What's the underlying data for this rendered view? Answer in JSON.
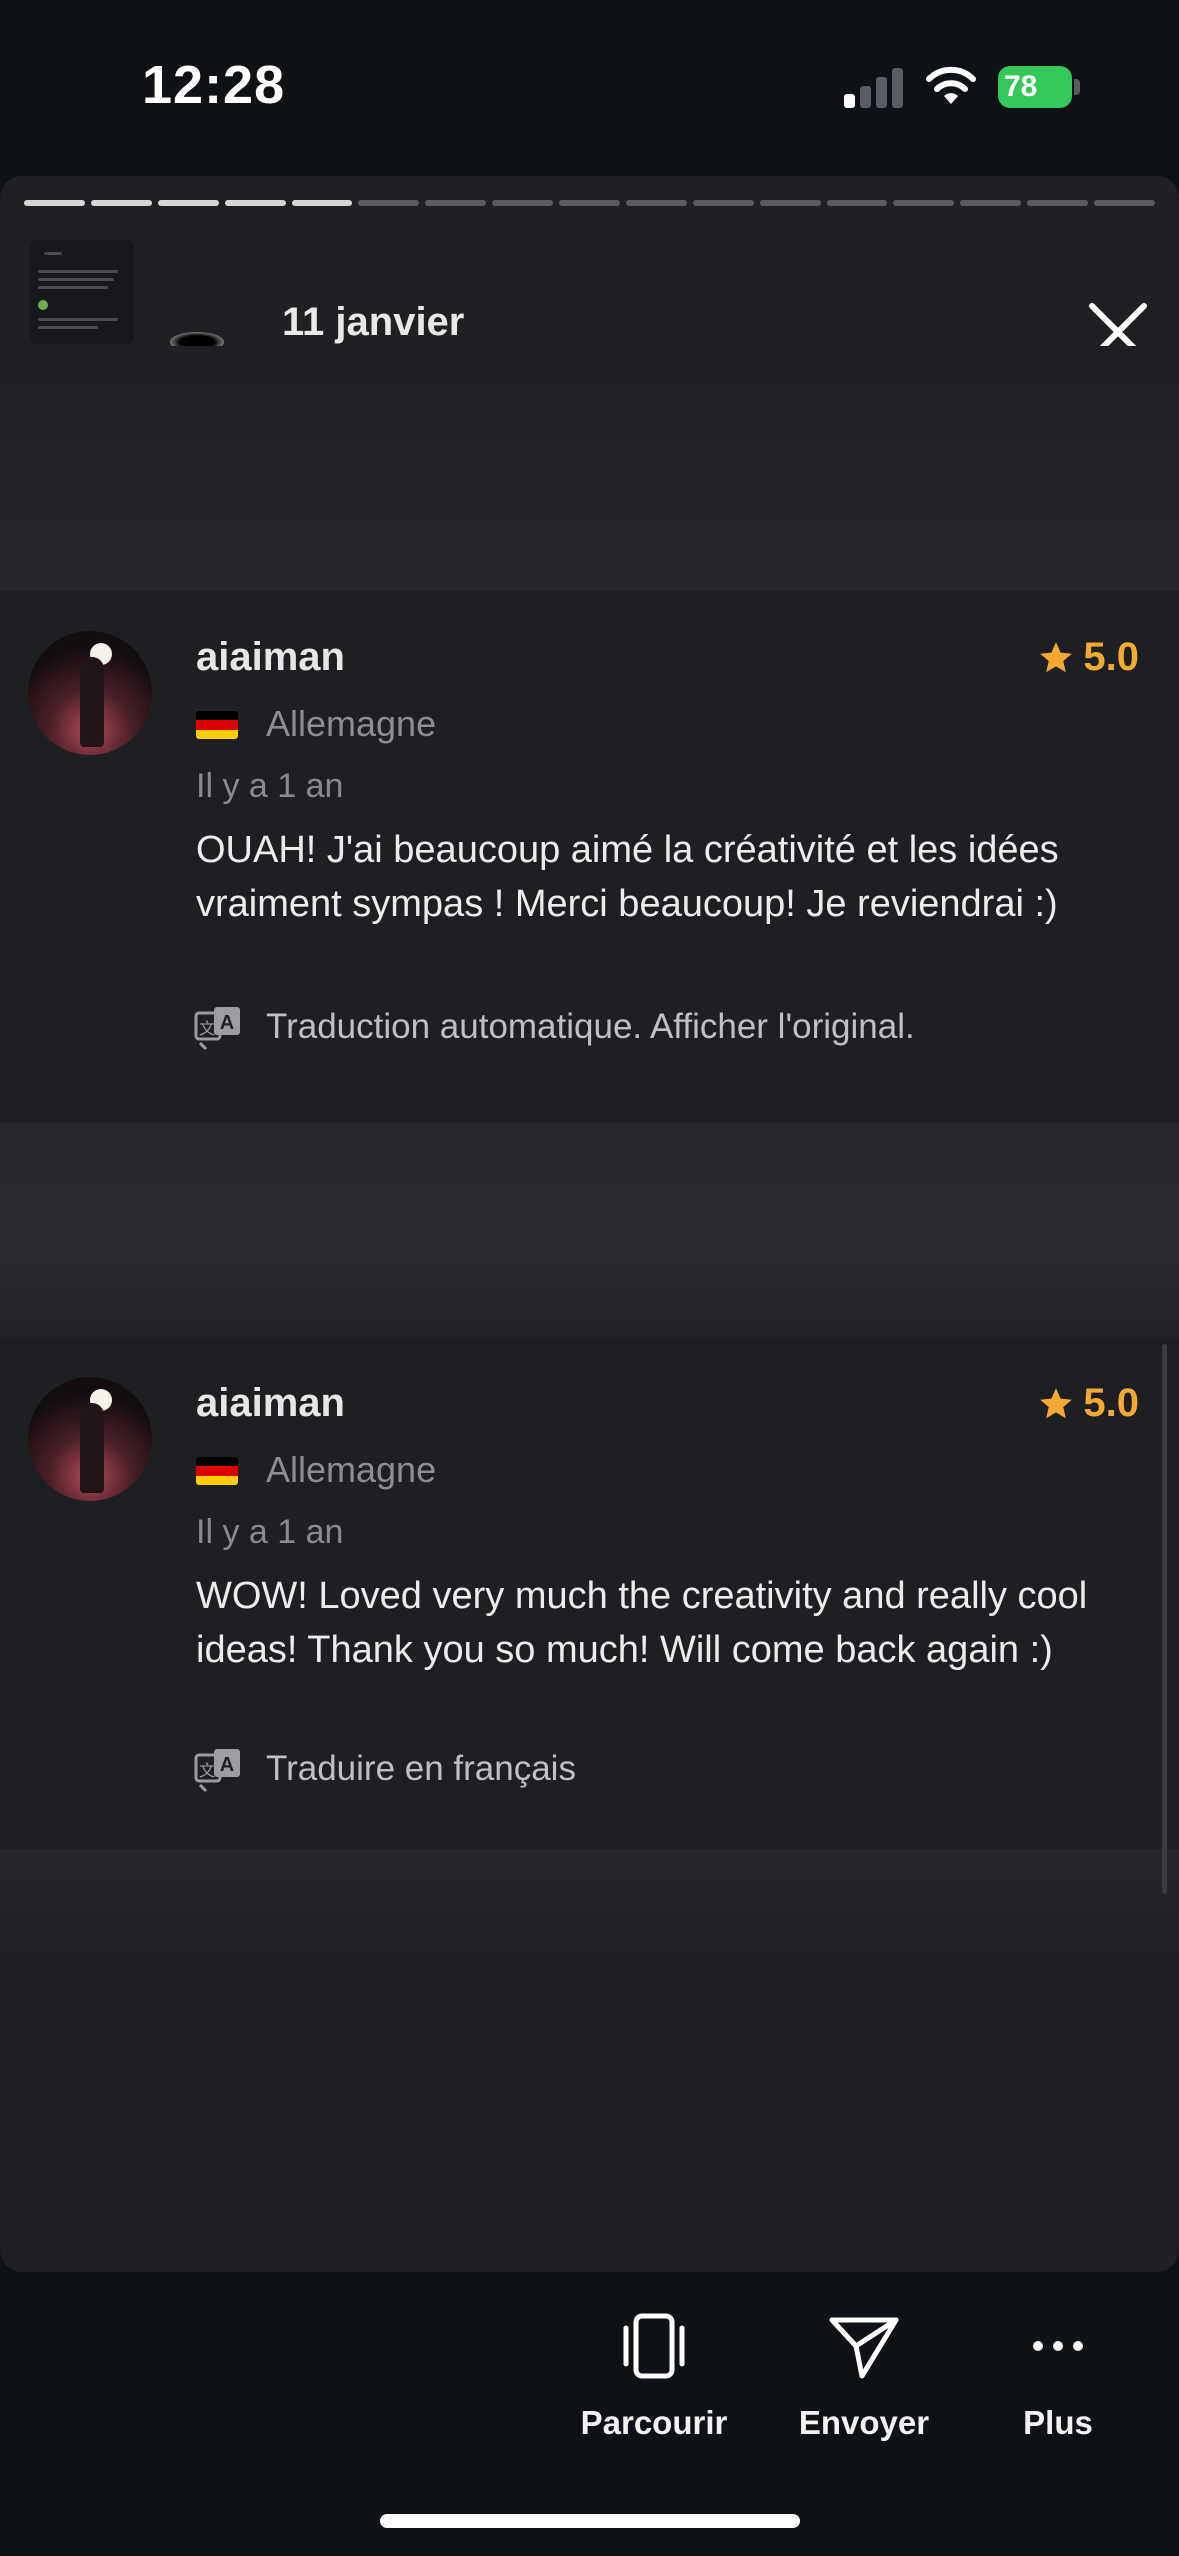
{
  "status_bar": {
    "time": "12:28",
    "battery": "78",
    "battery_color": "#34c759"
  },
  "story": {
    "date": "11 janvier",
    "progress_total": 17,
    "progress_done": 5,
    "close_icon": "close-icon"
  },
  "reviews": [
    {
      "username": "aiaiman",
      "rating": "5.0",
      "country": "Allemagne",
      "flag_icon": "germany-flag-icon",
      "time_ago": "Il y a 1 an",
      "text": "OUAH! J'ai beaucoup aimé la créativité et les idées vraiment sympas ! Merci beaucoup! Je reviendrai :)",
      "translate_label": "Traduction automatique. Afficher l'original."
    },
    {
      "username": "aiaiman",
      "rating": "5.0",
      "country": "Allemagne",
      "flag_icon": "germany-flag-icon",
      "time_ago": "Il y a 1 an",
      "text": "WOW! Loved very much the creativity and really cool ideas! Thank you so much! Will come back again :)",
      "translate_label": "Traduire en français"
    }
  ],
  "bottom_bar": {
    "browse_label": "Parcourir",
    "send_label": "Envoyer",
    "more_label": "Plus"
  },
  "colors": {
    "rating_accent": "#f4a932",
    "background": "#0e1116",
    "card": "#1e1f22"
  }
}
